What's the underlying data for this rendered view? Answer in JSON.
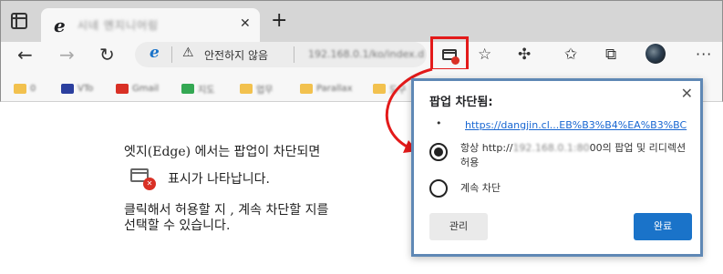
{
  "tab": {
    "title": "시네 엔지니어링",
    "close": "✕",
    "new_tab": "+"
  },
  "nav": {
    "back": "←",
    "forward": "→",
    "refresh": "↻"
  },
  "address": {
    "security_label": "안전하지 않음",
    "url": "192.168.0.1/ko/index.d"
  },
  "toolbar_icons": [
    "popup-blocked-icon",
    "add-favorite-icon",
    "extensions-icon",
    "favorites-icon",
    "collections-icon",
    "profile-avatar",
    "more-menu"
  ],
  "favorites": [
    {
      "label": "0"
    },
    {
      "label": "VTo"
    },
    {
      "label": "Gmail"
    },
    {
      "label": "지도"
    },
    {
      "label": "업무"
    },
    {
      "label": "Parallax"
    },
    {
      "label": "도구"
    }
  ],
  "content": {
    "line1": "엣지(Edge) 에서는 팝업이 차단되면",
    "line2": "표시가 나타납니다.",
    "line3": "클릭해서 허용할 지 , 계속 차단할 지를",
    "line4": "선택할 수 있습니다."
  },
  "dialog": {
    "title": "팝업 차단됨:",
    "bullet": "•",
    "link": "https://dangjin.cl...EB%B3%B4%EA%B3%BC",
    "option_allow_prefix": "항상 http://",
    "option_allow_ip": "192.168.0.1:80",
    "option_allow_suffix": "00의 팝업 및 리디렉션",
    "option_allow_line2": "허용",
    "option_block": "계속 차단",
    "manage_button": "관리",
    "done_button": "완료"
  },
  "colors": {
    "accent": "#1a73c9",
    "highlight_box": "#e31a1a",
    "dialog_border": "#5f88b5"
  }
}
